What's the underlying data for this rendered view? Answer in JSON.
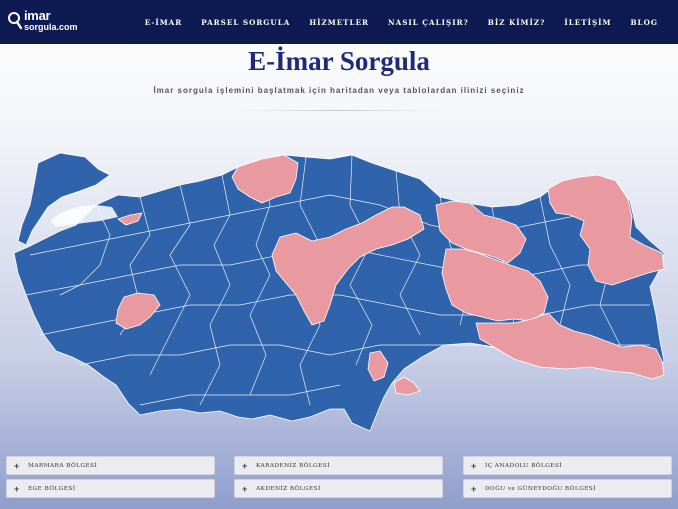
{
  "brand": {
    "line1": "imar",
    "line2": "sorgula.com"
  },
  "nav": [
    {
      "label": "E-İMAR"
    },
    {
      "label": "PARSEL SORGULA"
    },
    {
      "label": "HİZMETLER"
    },
    {
      "label": "NASIL ÇALIŞIR?"
    },
    {
      "label": "BİZ KİMİZ?"
    },
    {
      "label": "İLETİŞİM"
    },
    {
      "label": "BLOG"
    }
  ],
  "page": {
    "title": "E-İmar Sorgula",
    "subtitle": "İmar sorgula işlemini başlatmak için haritadan veya tablolardan ilinizi seçiniz"
  },
  "map": {
    "base_color": "#2f63ab",
    "highlight_color": "#e89aa0",
    "border_color": "#ffffff"
  },
  "regions": [
    {
      "label": "MARMARA BÖLGESİ"
    },
    {
      "label": "KARADENİZ BÖLGESİ"
    },
    {
      "label": "İÇ ANADOLU BÖLGESİ"
    },
    {
      "label": "EGE BÖLGESİ"
    },
    {
      "label": "AKDENİZ BÖLGESİ"
    },
    {
      "label": "DOĞU ve GÜNEYDOĞU BÖLGESİ"
    }
  ]
}
